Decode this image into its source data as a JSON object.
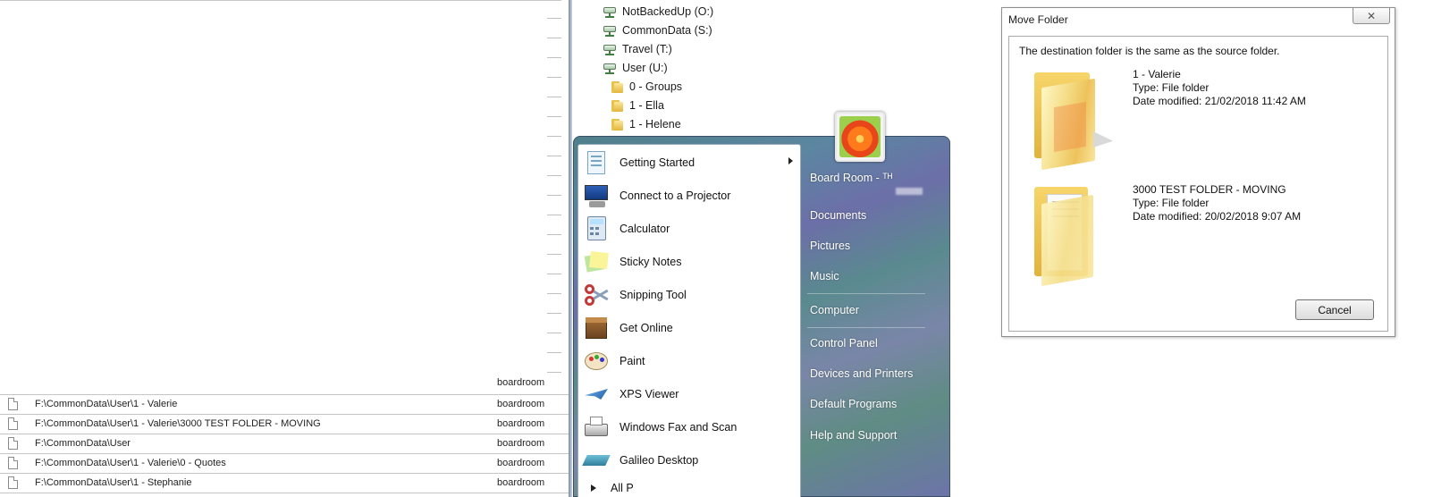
{
  "log_panel": {
    "empty_row_owner": "boardroom",
    "rows": [
      {
        "path": "F:\\CommonData\\User\\1 - Valerie",
        "owner": "boardroom"
      },
      {
        "path": "F:\\CommonData\\User\\1 - Valerie\\3000 TEST FOLDER - MOVING",
        "owner": "boardroom"
      },
      {
        "path": "F:\\CommonData\\User",
        "owner": "boardroom"
      },
      {
        "path": "F:\\CommonData\\User\\1 - Valerie\\0 - Quotes",
        "owner": "boardroom"
      },
      {
        "path": "F:\\CommonData\\User\\1 - Stephanie",
        "owner": "boardroom"
      }
    ]
  },
  "explorer_tree": {
    "drives": [
      "NotBackedUp (O:)",
      "CommonData (S:)",
      "Travel (T:)",
      "User (U:)"
    ],
    "folders": [
      "0 - Groups",
      "1 - Ella",
      "1 - Helene"
    ]
  },
  "start_menu": {
    "programs": [
      {
        "label": "Getting Started",
        "icon": "getting-started-icon",
        "submenu": true
      },
      {
        "label": "Connect to a Projector",
        "icon": "projector-icon",
        "submenu": false
      },
      {
        "label": "Calculator",
        "icon": "calculator-icon",
        "submenu": false
      },
      {
        "label": "Sticky Notes",
        "icon": "sticky-notes-icon",
        "submenu": false
      },
      {
        "label": "Snipping Tool",
        "icon": "scissors-icon",
        "submenu": false
      },
      {
        "label": "Get Online",
        "icon": "box-icon",
        "submenu": false
      },
      {
        "label": "Paint",
        "icon": "palette-icon",
        "submenu": false
      },
      {
        "label": "XPS Viewer",
        "icon": "xps-icon",
        "submenu": false
      },
      {
        "label": "Windows Fax and Scan",
        "icon": "fax-icon",
        "submenu": false
      },
      {
        "label": "Galileo Desktop",
        "icon": "galileo-icon",
        "submenu": false
      }
    ],
    "all_programs_partial": "All P",
    "user_name": "Board Room - ᵀᴴ",
    "right_items": [
      "Documents",
      "Pictures",
      "Music",
      "Computer",
      "Control Panel",
      "Devices and Printers",
      "Default Programs",
      "Help and Support"
    ]
  },
  "dialog": {
    "title": "Move Folder",
    "close_label": "✕",
    "message": "The destination folder is the same as the source folder.",
    "source": {
      "name": "1 - Valerie",
      "type": "Type: File folder",
      "modified": "Date modified: 21/02/2018 11:42 AM"
    },
    "destination": {
      "name": "3000 TEST FOLDER - MOVING",
      "type": "Type: File folder",
      "modified": "Date modified: 20/02/2018 9:07 AM"
    },
    "cancel_label": "Cancel"
  }
}
